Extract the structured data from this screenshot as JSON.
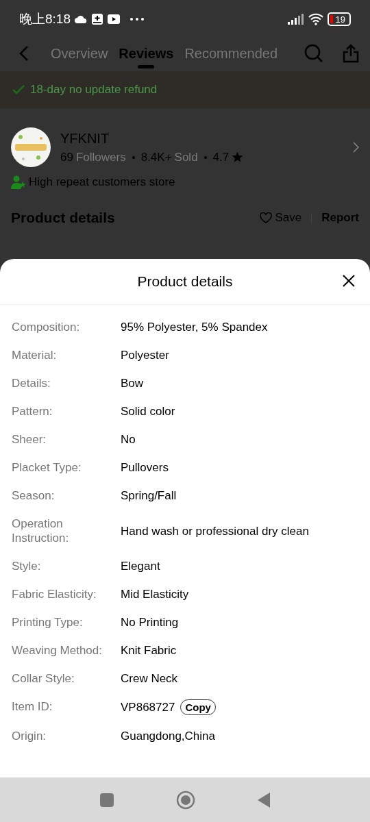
{
  "status_bar": {
    "time": "晚上8:18",
    "battery": "19"
  },
  "nav": {
    "tabs": [
      {
        "label": "Overview",
        "selected": false
      },
      {
        "label": "Reviews",
        "selected": true
      },
      {
        "label": "Recommended",
        "selected": false
      }
    ]
  },
  "banner": {
    "text": "18-day no update refund"
  },
  "store": {
    "name": "YFKNIT",
    "stats": [
      {
        "count": "69",
        "unit": "Followers"
      },
      {
        "count": "8.4K+",
        "unit": "Sold"
      }
    ],
    "rating": "4.7",
    "badge": "High repeat customers store"
  },
  "section": {
    "title": "Product details",
    "save": "Save",
    "report": "Report"
  },
  "sheet": {
    "title": "Product details",
    "rows": [
      {
        "label": "Composition:",
        "value": "95% Polyester, 5% Spandex"
      },
      {
        "label": "Material:",
        "value": "Polyester"
      },
      {
        "label": "Details:",
        "value": "Bow"
      },
      {
        "label": "Pattern:",
        "value": "Solid color"
      },
      {
        "label": "Sheer:",
        "value": "No"
      },
      {
        "label": "Placket Type:",
        "value": "Pullovers"
      },
      {
        "label": "Season:",
        "value": "Spring/Fall"
      },
      {
        "label": "Operation Instruction:",
        "value": "Hand wash or professional dry clean"
      },
      {
        "label": "Style:",
        "value": "Elegant"
      },
      {
        "label": "Fabric Elasticity:",
        "value": "Mid Elasticity"
      },
      {
        "label": "Printing Type:",
        "value": "No Printing"
      },
      {
        "label": "Weaving Method:",
        "value": "Knit Fabric"
      },
      {
        "label": "Collar Style:",
        "value": "Crew Neck"
      },
      {
        "label": "Item ID:",
        "value": "VP868727",
        "action": "Copy"
      },
      {
        "label": "Origin:",
        "value": "Guangdong,China"
      }
    ]
  }
}
